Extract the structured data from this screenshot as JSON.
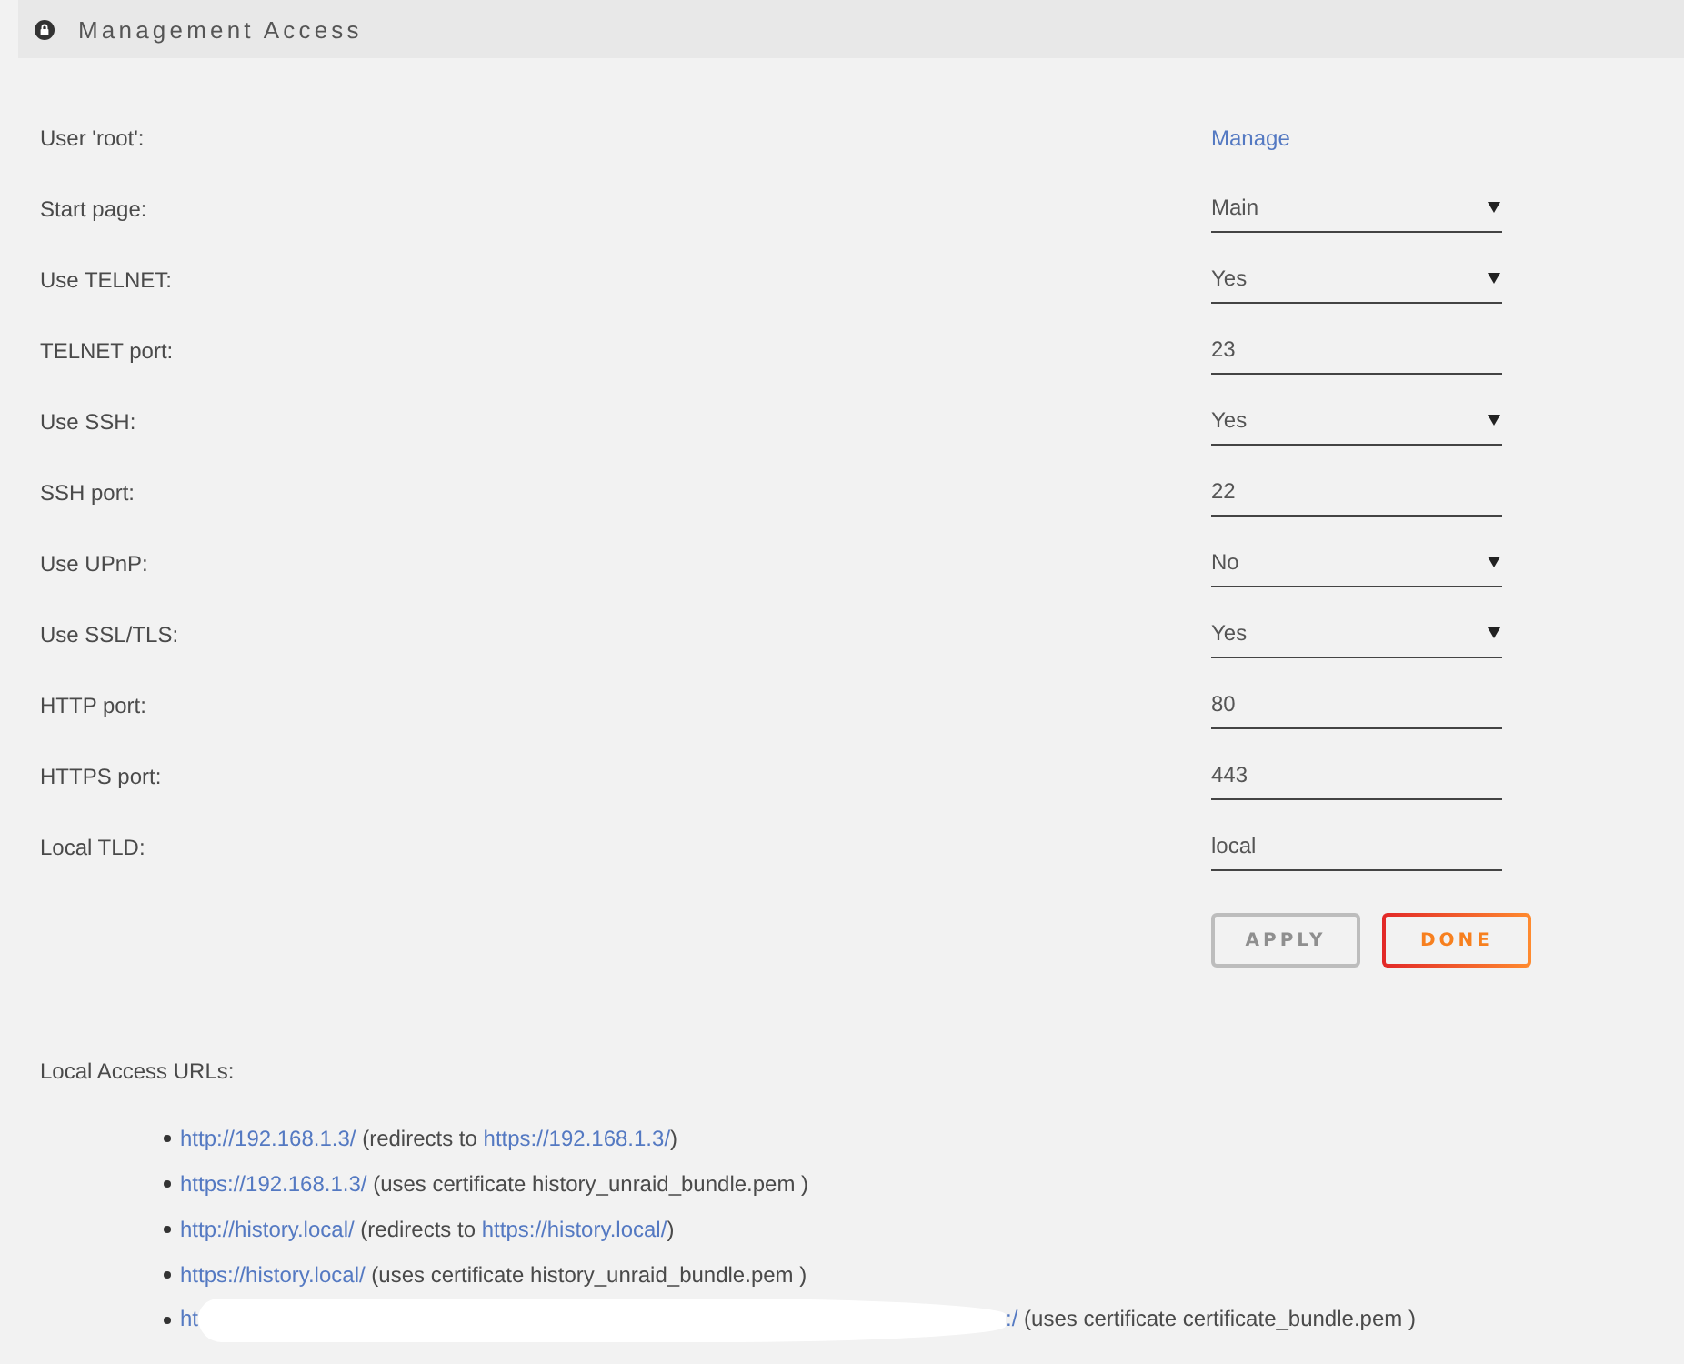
{
  "panel": {
    "title": "Management Access"
  },
  "settings": [
    {
      "label": "User 'root':",
      "kind": "link",
      "value": "Manage"
    },
    {
      "label": "Start page:",
      "kind": "select",
      "value": "Main"
    },
    {
      "label": "Use TELNET:",
      "kind": "select",
      "value": "Yes"
    },
    {
      "label": "TELNET port:",
      "kind": "text",
      "value": "23"
    },
    {
      "label": "Use SSH:",
      "kind": "select",
      "value": "Yes"
    },
    {
      "label": "SSH port:",
      "kind": "text",
      "value": "22"
    },
    {
      "label": "Use UPnP:",
      "kind": "select",
      "value": "No"
    },
    {
      "label": "Use SSL/TLS:",
      "kind": "select",
      "value": "Yes"
    },
    {
      "label": "HTTP port:",
      "kind": "text",
      "value": "80"
    },
    {
      "label": "HTTPS port:",
      "kind": "text",
      "value": "443"
    },
    {
      "label": "Local TLD:",
      "kind": "text",
      "value": "local"
    }
  ],
  "buttons": [
    {
      "label": "APPLY",
      "disabled": true
    },
    {
      "label": "DONE",
      "disabled": false
    }
  ],
  "local_access": {
    "heading": "Local Access URLs:",
    "items": [
      {
        "parts": [
          {
            "kind": "link",
            "text": "http://192.168.1.3/"
          },
          {
            "kind": "text",
            "text": " (redirects to "
          },
          {
            "kind": "link",
            "text": "https://192.168.1.3/"
          },
          {
            "kind": "text",
            "text": ")"
          }
        ]
      },
      {
        "parts": [
          {
            "kind": "link",
            "text": "https://192.168.1.3/"
          },
          {
            "kind": "text",
            "text": " (uses certificate history_unraid_bundle.pem )"
          }
        ]
      },
      {
        "parts": [
          {
            "kind": "link",
            "text": "http://history.local/"
          },
          {
            "kind": "text",
            "text": " (redirects to "
          },
          {
            "kind": "link",
            "text": "https://history.local/"
          },
          {
            "kind": "text",
            "text": ")"
          }
        ]
      },
      {
        "parts": [
          {
            "kind": "link",
            "text": "https://history.local/"
          },
          {
            "kind": "text",
            "text": " (uses certificate history_unraid_bundle.pem )"
          }
        ]
      },
      {
        "parts": [
          {
            "kind": "link",
            "text": "ht"
          },
          {
            "kind": "redacted"
          },
          {
            "kind": "link",
            "text": ":/"
          },
          {
            "kind": "text",
            "text": " (uses certificate certificate_bundle.pem )"
          }
        ]
      }
    ]
  }
}
